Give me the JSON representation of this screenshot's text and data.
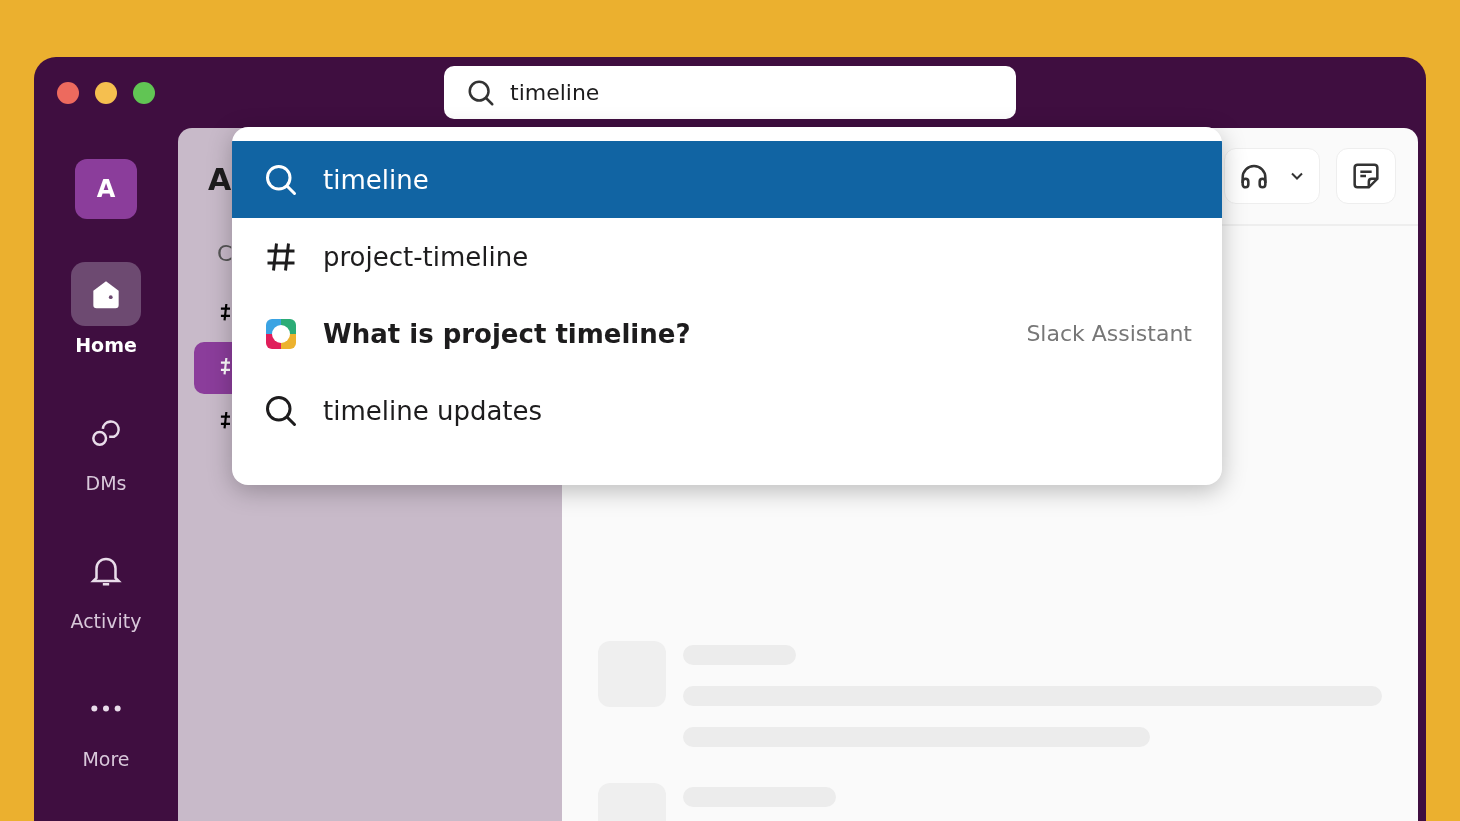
{
  "search": {
    "value": "timeline"
  },
  "rail": {
    "workspace": "A",
    "items": [
      {
        "kind": "home",
        "label": "Home",
        "selected": true
      },
      {
        "kind": "dms",
        "label": "DMs",
        "selected": false
      },
      {
        "kind": "activity",
        "label": "Activity",
        "selected": false
      },
      {
        "kind": "more",
        "label": "More",
        "selected": false
      }
    ]
  },
  "sidebar": {
    "title": "A",
    "section": "C",
    "channels": [
      {
        "selected": false
      },
      {
        "selected": true
      },
      {
        "selected": false
      }
    ]
  },
  "dropdown": {
    "items": [
      {
        "kind": "search",
        "label": "timeline",
        "selected": true
      },
      {
        "kind": "channel",
        "label": "project-timeline",
        "selected": false
      },
      {
        "kind": "assistant",
        "label": "What is project timeline?",
        "hint": "Slack Assistant",
        "selected": false
      },
      {
        "kind": "search",
        "label": "timeline updates",
        "selected": false
      }
    ]
  }
}
